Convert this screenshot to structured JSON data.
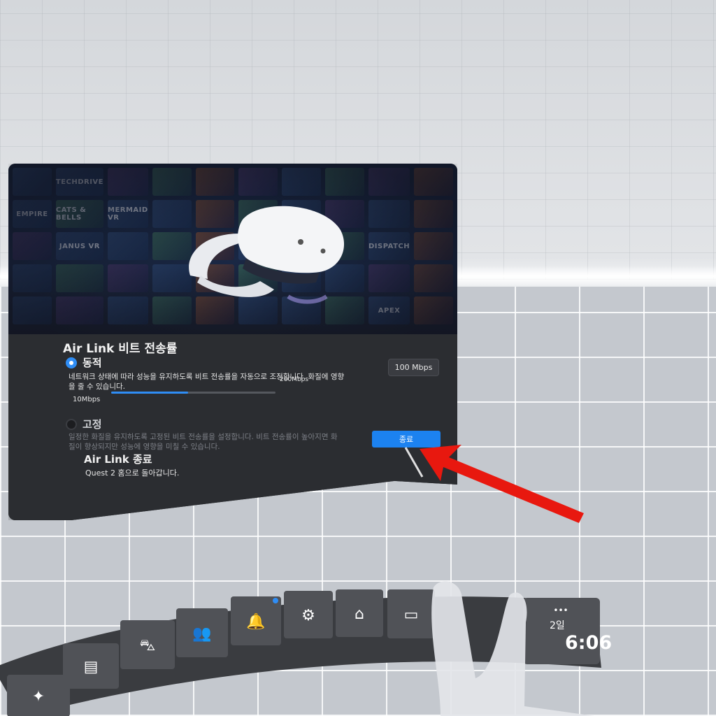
{
  "hero": {
    "tiles": [
      "",
      "TECHDRIVE",
      "",
      "",
      "",
      "",
      "",
      "",
      "",
      "",
      "EMPIRE",
      "CATS & BELLS",
      "MERMAID VR",
      "",
      "",
      "",
      "",
      "",
      "",
      "",
      "",
      "JANUS VR",
      "",
      "",
      "",
      "",
      "",
      "",
      "DISPATCH",
      "",
      "",
      "",
      "",
      "",
      "",
      "",
      "",
      "",
      "",
      "",
      "",
      "",
      "",
      "",
      "",
      "",
      "",
      "",
      "APEX",
      ""
    ]
  },
  "dialog": {
    "title": "Air Link 비트 전송률",
    "dynamic": {
      "label": "동적",
      "selected": true,
      "description": "네트워크 상태에 따라 성능을 유지하도록 비트 전송률을 자동으로 조정합니다. 화질에 영향을 줄 수 있습니다.",
      "value": "100 Mbps",
      "slider_min": "10Mbps",
      "slider_max": "200Mbps",
      "slider_fraction": 0.47
    },
    "fixed": {
      "label": "고정",
      "selected": false,
      "description": "일정한 화질을 유지하도록 고정된 비트 전송률을 설정합니다. 비트 전송률이 높아지면 화질이 향상되지만 성능에 영향을 미칠 수 있습니다."
    },
    "end": {
      "title": "Air Link 종료",
      "description": "Quest 2 홈으로 돌아갑니다.",
      "button_label": "종료"
    }
  },
  "dock": {
    "items": [
      {
        "name": "explore",
        "icon": "compass-icon"
      },
      {
        "name": "library",
        "icon": "book-icon"
      },
      {
        "name": "store",
        "icon": "shopping-bag-icon"
      },
      {
        "name": "people",
        "icon": "people-icon"
      },
      {
        "name": "notifications",
        "icon": "bell-icon",
        "has_badge": true
      },
      {
        "name": "settings",
        "icon": "gear-icon"
      },
      {
        "name": "home",
        "icon": "home-icon"
      },
      {
        "name": "desktop",
        "icon": "monitor-icon"
      }
    ],
    "date_fragment": "2일",
    "time_fragment": "6:06",
    "more": "•••"
  },
  "colors": {
    "accent": "#1c82f0",
    "arrow": "#e8180f",
    "panel": "#2b2d31"
  }
}
